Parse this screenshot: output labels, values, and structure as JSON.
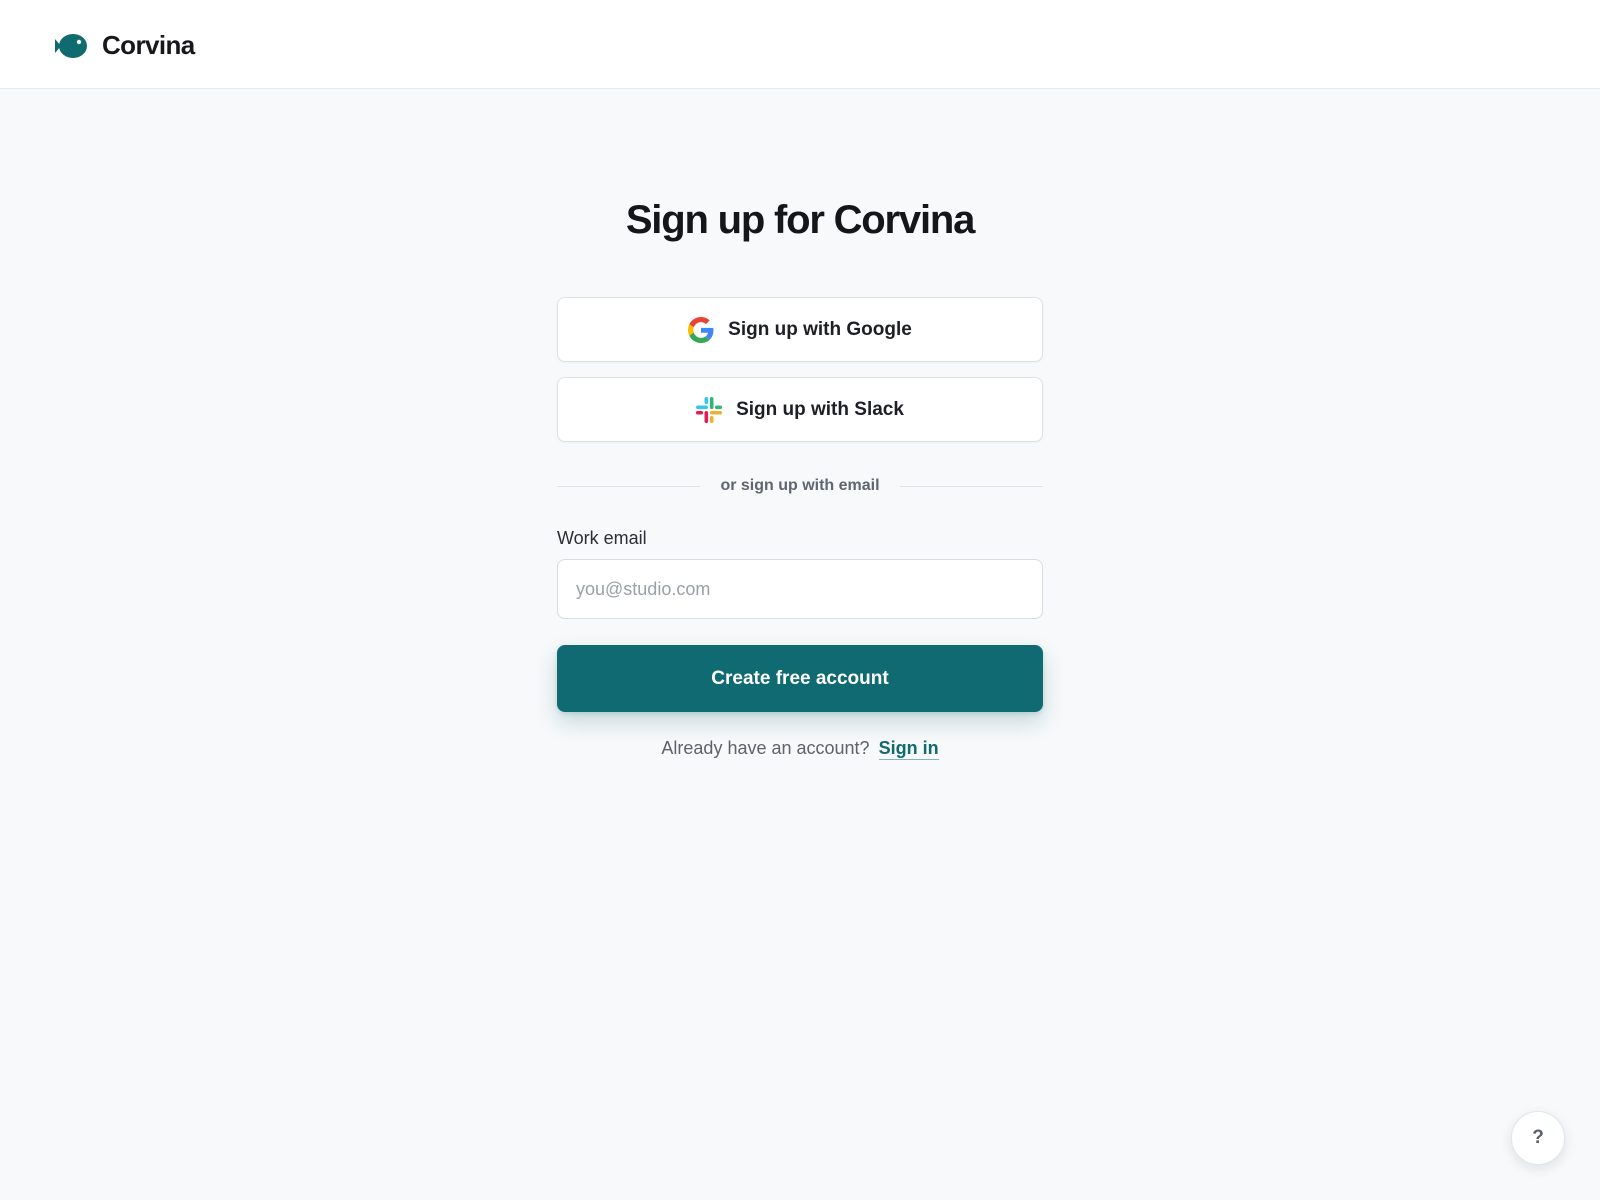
{
  "brand": {
    "name": "Corvina",
    "logo_icon": "fish-logo-icon",
    "color": "#0f6b6f"
  },
  "page": {
    "title": "Sign up for Corvina"
  },
  "sso": {
    "google": {
      "label": "Sign up with Google",
      "icon": "google-icon"
    },
    "slack": {
      "label": "Sign up with Slack",
      "icon": "slack-icon"
    }
  },
  "divider": {
    "text": "or sign up with email"
  },
  "email": {
    "label": "Work email",
    "value": "",
    "placeholder": "you@studio.com"
  },
  "cta": {
    "label": "Create free account",
    "color": "#106a71"
  },
  "signin": {
    "prompt": "Already have an account?",
    "link_label": "Sign in"
  },
  "help": {
    "label": "?",
    "icon": "help-icon"
  }
}
